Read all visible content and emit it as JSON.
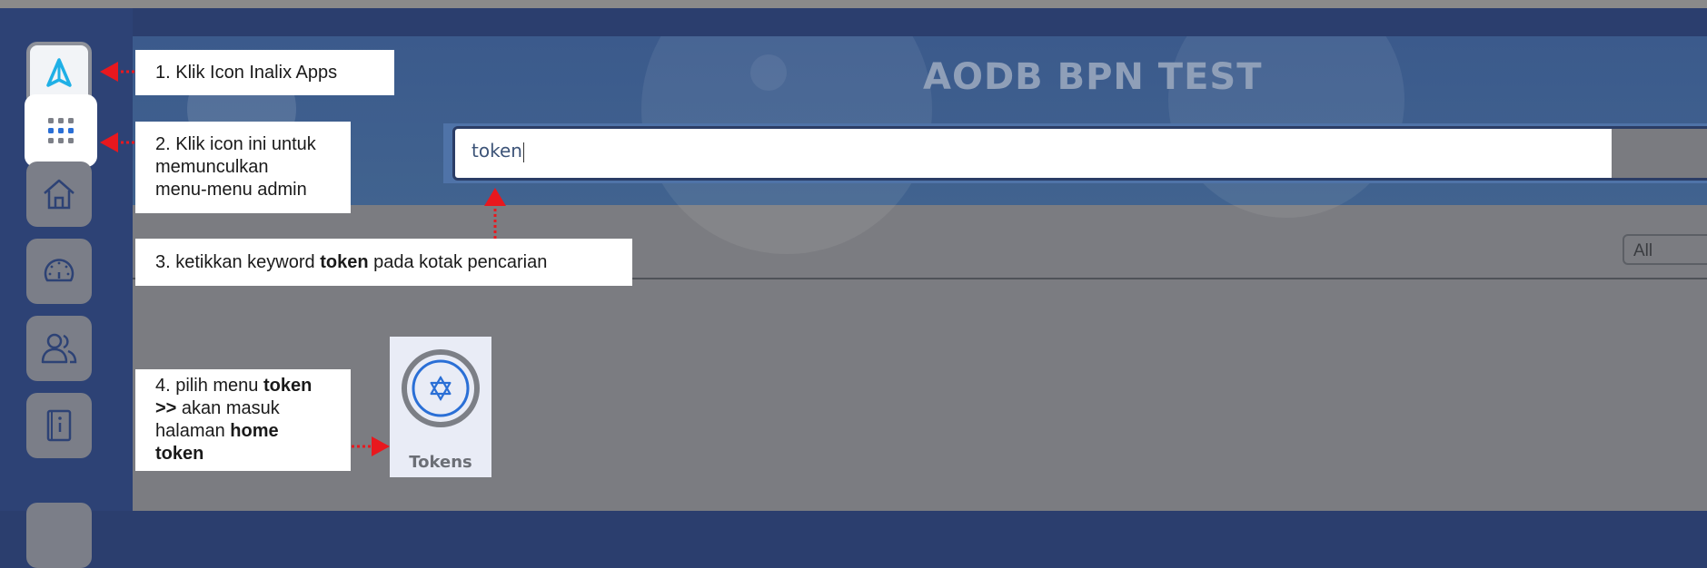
{
  "app": {
    "title": "AODB BPN TEST"
  },
  "search": {
    "value": "token"
  },
  "filter": {
    "selected": "All"
  },
  "sidebar": {
    "items": [
      {
        "icon": "inalix-logo-icon"
      },
      {
        "icon": "grid-menu-icon"
      },
      {
        "icon": "home-icon"
      },
      {
        "icon": "dashboard-gauge-icon"
      },
      {
        "icon": "users-icon"
      },
      {
        "icon": "info-book-icon"
      }
    ]
  },
  "tile": {
    "label": "Tokens",
    "icon": "star-badge-icon"
  },
  "callouts": {
    "c1": {
      "text": "1. Klik Icon Inalix Apps"
    },
    "c2": {
      "lines": [
        "2. Klik icon ini untuk",
        "memunculkan",
        "menu-menu admin"
      ]
    },
    "c3": {
      "pre": "3. ketikkan keyword ",
      "bold": "token",
      "post": " pada kotak pencarian"
    },
    "c4": {
      "l1_pre": "4. pilih menu ",
      "l1_bold": "token",
      "l2_bold": ">>",
      "l2_post": " akan masuk",
      "l3_pre": "halaman ",
      "l3_bold": "home",
      "l4_bold": "token"
    }
  },
  "colors": {
    "sidebar": "#2d4275",
    "accent": "#4f73a8",
    "annotation_arrow": "#e8181e",
    "icon_blue": "#2a6fd6"
  }
}
